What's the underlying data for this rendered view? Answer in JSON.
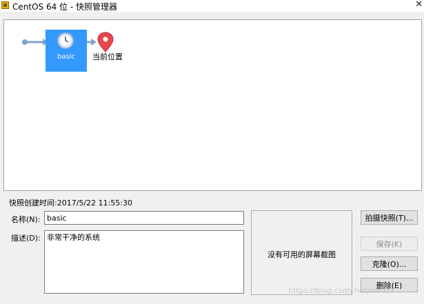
{
  "window": {
    "title": "CentOS 64 位 - 快照管理器",
    "icon": "vmware-app-icon",
    "close_glyph": "✕"
  },
  "tree": {
    "snapshot_name": "basic",
    "snapshot_icon": "clock-icon",
    "current_location_label": "当前位置",
    "current_location_icon": "map-pin-icon",
    "accent_color": "#3399ff",
    "pin_color": "#e8474c"
  },
  "details": {
    "created_label": "快照创建时间:2017/5/22 11:55:30",
    "name_label": "名称(N):",
    "name_value": "basic",
    "description_label": "描述(D):",
    "description_value": "非常干净的系统",
    "preview_text": "没有可用的屏幕截图"
  },
  "buttons": {
    "take_snapshot": "拍摄快照(T)...",
    "keep": "保存(K)",
    "clone": "克隆(O)...",
    "delete": "删除(E)"
  },
  "watermark": "https://blog.csdn.net/weixin"
}
